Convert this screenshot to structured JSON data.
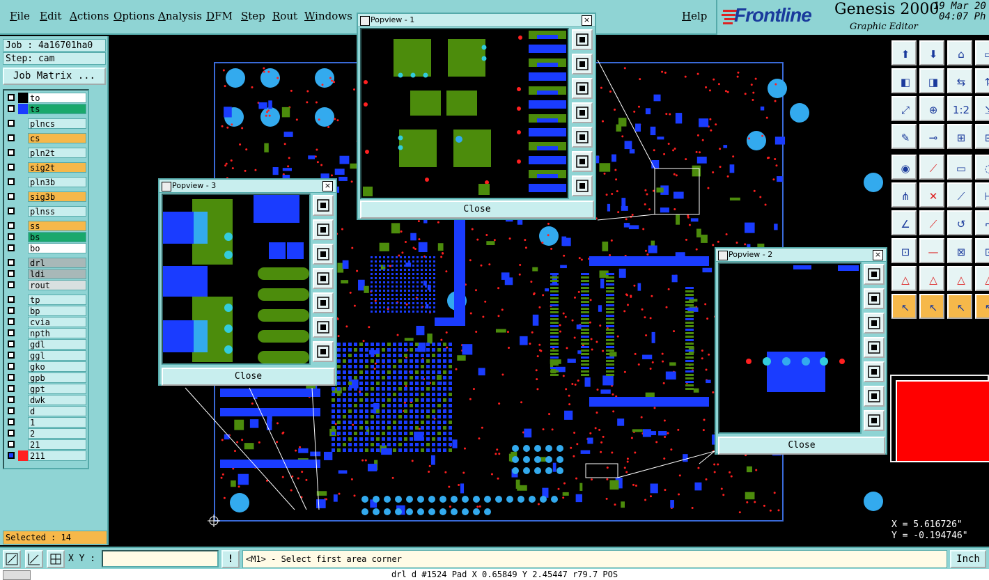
{
  "menubar": {
    "items": [
      "File",
      "Edit",
      "Actions",
      "Options",
      "Analysis",
      "DFM",
      "Step",
      "Rout",
      "Windows"
    ],
    "help": "Help"
  },
  "brand": {
    "logo": "Frontline",
    "product": "Genesis 2000",
    "subtitle": "Graphic Editor",
    "date": "19 Mar 20",
    "time": "04:07 Ph"
  },
  "job": {
    "job_label": "Job : 4a16701ha0",
    "step_label": "Step: cam",
    "matrix_button": "Job Matrix ..."
  },
  "layers": [
    {
      "name": "to",
      "color": "#ffffff",
      "swatch": "#000000"
    },
    {
      "name": "ts",
      "color": "#1aa86c",
      "swatch": "#1a3cff"
    },
    {
      "name": "plncs",
      "color": "#c8eeee",
      "swatch": ""
    },
    {
      "name": "cs",
      "color": "#f6b84a",
      "swatch": ""
    },
    {
      "name": "pln2t",
      "color": "#c8eeee",
      "swatch": ""
    },
    {
      "name": "sig2t",
      "color": "#f6b84a",
      "swatch": ""
    },
    {
      "name": "pln3b",
      "color": "#c8eeee",
      "swatch": ""
    },
    {
      "name": "sig3b",
      "color": "#f6b84a",
      "swatch": ""
    },
    {
      "name": "plnss",
      "color": "#c8eeee",
      "swatch": ""
    },
    {
      "name": "ss",
      "color": "#f6b84a",
      "swatch": ""
    },
    {
      "name": "bs",
      "color": "#1aa86c",
      "swatch": ""
    },
    {
      "name": "bo",
      "color": "#ffffff",
      "swatch": ""
    }
  ],
  "drill_layers": [
    {
      "name": "drl",
      "color": "#a8b8b8"
    },
    {
      "name": "ldi",
      "color": "#a8b8b8"
    },
    {
      "name": "rout",
      "color": "#d8e0e0"
    }
  ],
  "misc_layers": [
    {
      "name": "tp"
    },
    {
      "name": "bp"
    },
    {
      "name": "cvia"
    },
    {
      "name": "npth"
    },
    {
      "name": "gdl"
    },
    {
      "name": "ggl"
    },
    {
      "name": "gko"
    },
    {
      "name": "gpb"
    },
    {
      "name": "gpt"
    },
    {
      "name": "dwk"
    },
    {
      "name": "d"
    },
    {
      "name": "1"
    },
    {
      "name": "2"
    },
    {
      "name": "21"
    },
    {
      "name": "211"
    }
  ],
  "selected": "Selected : 14",
  "popviews": [
    {
      "title": "Popview - 1",
      "close": "Close"
    },
    {
      "title": "Popview - 3",
      "close": "Close"
    },
    {
      "title": "Popview - 2",
      "close": "Close"
    }
  ],
  "coords": {
    "x": "X = 5.616726\"",
    "y": "Y = -0.194746\""
  },
  "bottom": {
    "xy_label": "X Y :",
    "xy_value": "",
    "prompt": "<M1> - Select first area corner",
    "units": "Inch"
  },
  "statusline": "drl d #1524 Pad X 0.65849 Y 2.45447 r79.7 POS",
  "colors": {
    "panel": "#8fd4d4",
    "light": "#c8eeee",
    "pad_blue": "#1a3cff",
    "copper_green": "#4c8c0c",
    "drill_red": "#ff2020",
    "cyan": "#33ccdd"
  }
}
